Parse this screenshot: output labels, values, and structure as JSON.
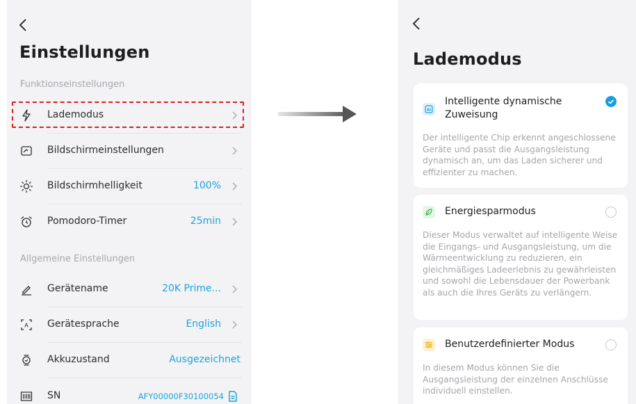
{
  "settings": {
    "title": "Einstellungen",
    "section1": "Funktionseinstellungen",
    "section2": "Allgemeine Einstellungen",
    "rows": [
      {
        "label": "Lademodus",
        "value": ""
      },
      {
        "label": "Bildschirmeinstellungen",
        "value": ""
      },
      {
        "label": "Bildschirmhelligkeit",
        "value": "100%"
      },
      {
        "label": "Pomodoro-Timer",
        "value": "25min"
      },
      {
        "label": "Gerätename",
        "value": "20K Prime..."
      },
      {
        "label": "Gerätesprache",
        "value": "English"
      },
      {
        "label": "Akkuzustand",
        "value": "Ausgezeichnet"
      },
      {
        "label": "SN",
        "value": "AFY00000F30100054"
      }
    ]
  },
  "lademodus": {
    "title": "Lademodus",
    "options": [
      {
        "title_line1": "Intelligente dynamische",
        "title_line2": "Zuweisung",
        "selected": true,
        "desc": "Der intelligente Chip erkennt angeschlossene Geräte und passt die Ausgangsleistung dynamisch an, um das Laden sicherer und effizienter zu machen."
      },
      {
        "title_line1": "Energiesparmodus",
        "selected": false,
        "desc": "Dieser Modus verwaltet auf intelligente Weise die Eingangs- und Ausgangsleistung, um die Wärmeentwicklung zu reduzieren, ein gleichmäßiges Ladeerlebnis zu gewährleisten und sowohl die Lebensdauer der Powerbank als auch die Ihres Geräts zu verlängern."
      },
      {
        "title_line1": "Benutzerdefinierter Modus",
        "selected": false,
        "desc": "In diesem Modus können Sie die Ausgangsleistung der einzelnen Anschlüsse individuell einstellen."
      }
    ]
  },
  "colors": {
    "accent": "#1aa3d9",
    "highlight": "#d42020",
    "background": "#f3f3f5"
  },
  "icons": [
    "back-icon",
    "lightning-icon",
    "screen-icon",
    "brightness-icon",
    "alarm-icon",
    "pen-icon",
    "language-icon",
    "battery-health-icon",
    "barcode-icon",
    "copy-icon",
    "chevron-right-icon",
    "ai-chip-icon",
    "leaf-icon",
    "sliders-icon",
    "check-icon"
  ]
}
